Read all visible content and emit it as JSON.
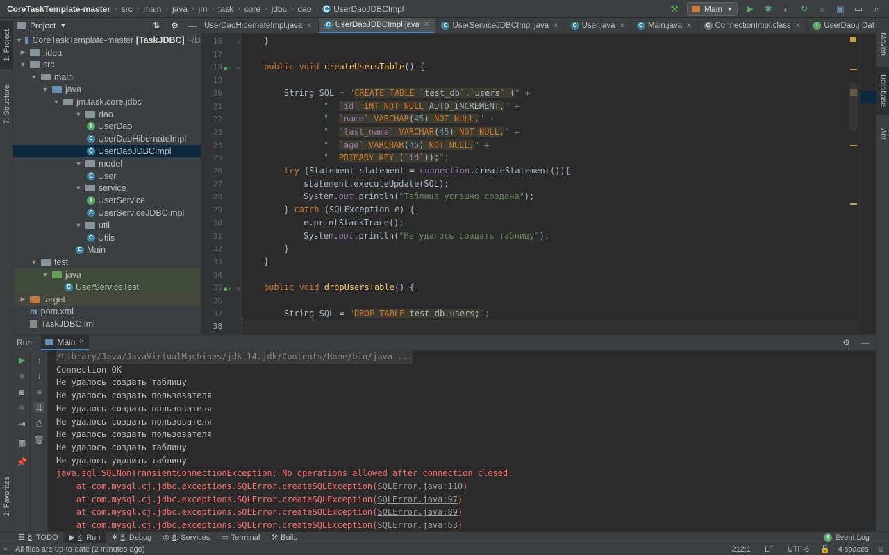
{
  "breadcrumb": [
    "CoreTaskTemplate-master",
    "src",
    "main",
    "java",
    "jm",
    "task",
    "core",
    "jdbc",
    "dao",
    "UserDaoJDBCImpl"
  ],
  "run_config": "Main",
  "left_tabs": {
    "project": "1: Project",
    "structure": "7: Structure",
    "favorites": "2: Favorites"
  },
  "right_tabs": {
    "maven": "Maven",
    "database": "Database",
    "ant": "Ant"
  },
  "project_panel": {
    "title": "Project",
    "tree": [
      {
        "label": "CoreTaskTemplate-master",
        "bold": "[TaskJDBC]",
        "suffix": "~/D"
      },
      {
        "label": ".idea"
      },
      {
        "label": "src"
      },
      {
        "label": "main"
      },
      {
        "label": "java"
      },
      {
        "label": "jm.task.core.jdbc"
      },
      {
        "label": "dao"
      },
      {
        "label": "UserDao"
      },
      {
        "label": "UserDaoHibernateImpl"
      },
      {
        "label": "UserDaoJDBCImpl"
      },
      {
        "label": "model"
      },
      {
        "label": "User"
      },
      {
        "label": "service"
      },
      {
        "label": "UserService"
      },
      {
        "label": "UserServiceJDBCImpl"
      },
      {
        "label": "util"
      },
      {
        "label": "Utils"
      },
      {
        "label": "Main"
      },
      {
        "label": "test"
      },
      {
        "label": "java"
      },
      {
        "label": "UserServiceTest"
      },
      {
        "label": "target"
      },
      {
        "label": "pom.xml"
      },
      {
        "label": "TaskJDBC.iml"
      }
    ]
  },
  "editor_tabs": [
    "UserDaoHibernateImpl.java",
    "UserDaoJDBCImpl.java",
    "UserServiceJDBCImpl.java",
    "User.java",
    "Main.java",
    "ConnectionImpl.class",
    "UserDao.java"
  ],
  "editor_tab_extra": "Dat",
  "line_numbers": [
    "16",
    "17",
    "18",
    "19",
    "20",
    "21",
    "22",
    "23",
    "24",
    "25",
    "26",
    "27",
    "28",
    "29",
    "30",
    "31",
    "32",
    "33",
    "34",
    "35",
    "36",
    "37",
    "38"
  ],
  "code": {
    "l16": "}",
    "l18_kw": "public void ",
    "l18_fn": "createUsersTable",
    "l18_rest": "() {",
    "l20_a": "String SQL = ",
    "l20_q": "\"",
    "l20_sql1": "CREATE TABLE ",
    "l20_sql2": "`test_db`",
    "l20_sql3": ".",
    "l20_sql4": "`users`",
    "l20_sql5": " (",
    "l20_end": "\" +",
    "l21_q": "\"  ",
    "l21_id": "`id`",
    "l21_kw": " INT NOT NULL ",
    "l21_tx": "AUTO_INCREMENT,",
    "l21_end": "\" +",
    "l22_q": "\"  ",
    "l22_id": "`name`",
    "l22_kw1": " VARCHAR",
    "l22_p1": "(",
    "l22_num": "45",
    "l22_p2": ")",
    "l22_kw2": " NOT NULL,",
    "l22_end": "\" +",
    "l23_q": "\"  ",
    "l23_id": "`last_name`",
    "l23_kw1": " VARCHAR",
    "l23_p1": "(",
    "l23_num": "45",
    "l23_p2": ")",
    "l23_kw2": " NOT NULL,",
    "l23_end": "\" +",
    "l24_q": "\"  ",
    "l24_id": "`age`",
    "l24_kw1": " VARCHAR",
    "l24_p1": "(",
    "l24_num": "45",
    "l24_p2": ")",
    "l24_kw2": " NOT NULL,",
    "l24_end": "\" +",
    "l25_q": "\"  ",
    "l25_kw": "PRIMARY KEY ",
    "l25_p1": "(",
    "l25_id": "`id`",
    "l25_p2": "));",
    "l25_end": "\";",
    "l26_kw": "try ",
    "l26_a": "(Statement statement = ",
    "l26_fld": "connection",
    "l26_b": ".createStatement()){",
    "l27": "statement.executeUpdate(SQL);",
    "l28_a": "System.",
    "l28_out": "out",
    "l28_b": ".println(",
    "l28_str": "\"Таблица успешно создана\"",
    "l28_c": ");",
    "l29_a": "} ",
    "l29_kw": "catch ",
    "l29_b": "(SQLException e) {",
    "l30": "e.printStackTrace();",
    "l31_a": "System.",
    "l31_out": "out",
    "l31_b": ".println(",
    "l31_str": "\"Не удалось создать таблицу\"",
    "l31_c": ");",
    "l32": "}",
    "l33": "}",
    "l35_kw": "public void ",
    "l35_fn": "dropUsersTable",
    "l35_rest": "() {",
    "l37_a": "String SQL = ",
    "l37_q": "\"",
    "l37_sql1": "DROP TABLE ",
    "l37_sql2": "test_db.users;",
    "l37_end": "\";"
  },
  "run_panel": {
    "label": "Run:",
    "tab": "Main",
    "lines": [
      "/Library/Java/JavaVirtualMachines/jdk-14.jdk/Contents/Home/bin/java ...",
      "Connection OK",
      "Не удалось создать таблицу",
      "Не удалось создать пользователя",
      "Не удалось создать пользователя",
      "Не удалось создать пользователя",
      "Не удалось создать пользователя",
      "Не удалось создать таблицу",
      "Не удалось удалить таблицу"
    ],
    "error": "java.sql.SQLNonTransientConnectionException: No operations allowed after connection closed.",
    "stack": [
      {
        "text": "    at com.mysql.cj.jdbc.exceptions.SQLError.createSQLException(",
        "link": "SQLError.java:110",
        "end": ")"
      },
      {
        "text": "    at com.mysql.cj.jdbc.exceptions.SQLError.createSQLException(",
        "link": "SQLError.java:97",
        "end": ")"
      },
      {
        "text": "    at com.mysql.cj.jdbc.exceptions.SQLError.createSQLException(",
        "link": "SQLError.java:89",
        "end": ")"
      },
      {
        "text": "    at com.mysql.cj.jdbc.exceptions.SQLError.createSQLException(",
        "link": "SQLError.java:63",
        "end": ")"
      }
    ]
  },
  "bottom_tabs": {
    "todo_n": "6",
    "todo": ": TODO",
    "run_n": "4",
    "run": ": Run",
    "debug_n": "5",
    "debug": ": Debug",
    "services_n": "8",
    "services": ": Services",
    "terminal": "Terminal",
    "build": "Build",
    "event_n": "6",
    "event": "Event Log"
  },
  "status": {
    "message": "All files are up-to-date (2 minutes ago)",
    "position": "212:1",
    "line_sep": "LF",
    "encoding": "UTF-8",
    "indent": "4 spaces"
  }
}
